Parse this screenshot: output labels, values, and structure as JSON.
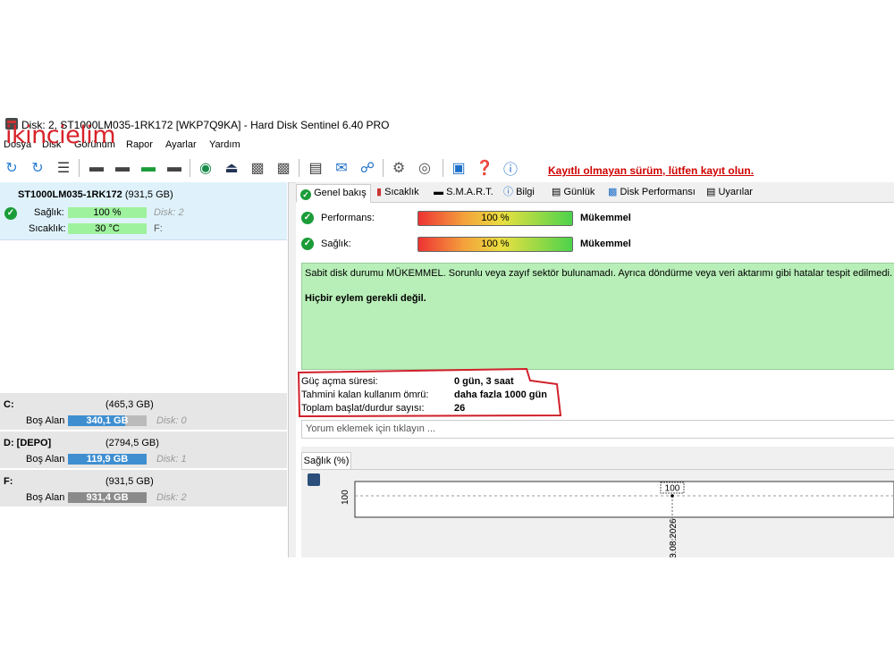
{
  "watermark": "ikincielim",
  "window": {
    "title": "Disk: 2, ST1000LM035-1RK172 [WKP7Q9KA]  -  Hard Disk Sentinel 6.40 PRO"
  },
  "menu": [
    "Dosya",
    "Disk",
    "Görünüm",
    "Rapor",
    "Ayarlar",
    "Yardım"
  ],
  "toolbar": {
    "register_link": "Kayıtlı olmayan sürüm, lütfen kayıt olun."
  },
  "disk": {
    "name": "ST1000LM035-1RK172",
    "size": "(931,5 GB)",
    "health_label": "Sağlık:",
    "health_value": "100 %",
    "health_fraction": 1.0,
    "health_disk": "Disk: 2",
    "temp_label": "Sıcaklık:",
    "temp_value": "30 °C",
    "temp_drive": "F:"
  },
  "volumes": [
    {
      "letter": "C:",
      "size": "(465,3 GB)",
      "free_label": "Boş Alan",
      "free": "340,1 GB",
      "free_fraction": 0.73,
      "disk": "Disk: 0",
      "color": "#3f8fd0"
    },
    {
      "letter": "D: [DEPO]",
      "size": "(2794,5 GB)",
      "free_label": "Boş Alan",
      "free": "119,9 GB",
      "free_fraction": 0.04,
      "disk": "Disk: 1",
      "color": "#3f8fd0"
    },
    {
      "letter": "F:",
      "size": "(931,5 GB)",
      "free_label": "Boş Alan",
      "free": "931,4 GB",
      "free_fraction": 0.99,
      "disk": "Disk: 2",
      "color": "#8a8a8a"
    }
  ],
  "tabs": [
    "Genel bakış",
    "Sıcaklık",
    "S.M.A.R.T.",
    "Bilgi",
    "Günlük",
    "Disk Performansı",
    "Uyarılar"
  ],
  "overview": {
    "performance_label": "Performans:",
    "performance_value": "100 %",
    "performance_rating": "Mükemmel",
    "health_label": "Sağlık:",
    "health_value": "100 %",
    "health_rating": "Mükemmel",
    "status_text": "Sabit disk durumu MÜKEMMEL. Sorunlu veya zayıf sektör bulunamadı. Ayrıca döndürme veya veri aktarımı gibi hatalar tespit edilmedi.",
    "action_text": "Hiçbir eylem gerekli değil."
  },
  "info": [
    {
      "label": "Güç açma süresi:",
      "value": "0 gün, 3 saat"
    },
    {
      "label": "Tahmini kalan kullanım ömrü:",
      "value": "daha fazla 1000 gün"
    },
    {
      "label": "Toplam başlat/durdur sayısı:",
      "value": "26"
    }
  ],
  "comment_placeholder": "Yorum eklemek için tıklayın ...",
  "chart_tab": "Sağlık (%)",
  "chart_data": {
    "type": "line",
    "x": [
      "3.08.2026"
    ],
    "series": [
      {
        "values": [
          100
        ]
      }
    ],
    "ylabel": "",
    "y_tick_labels": [
      "100"
    ],
    "data_labels": [
      "100"
    ],
    "x_tick_labels": [
      "3.08.2026"
    ]
  }
}
